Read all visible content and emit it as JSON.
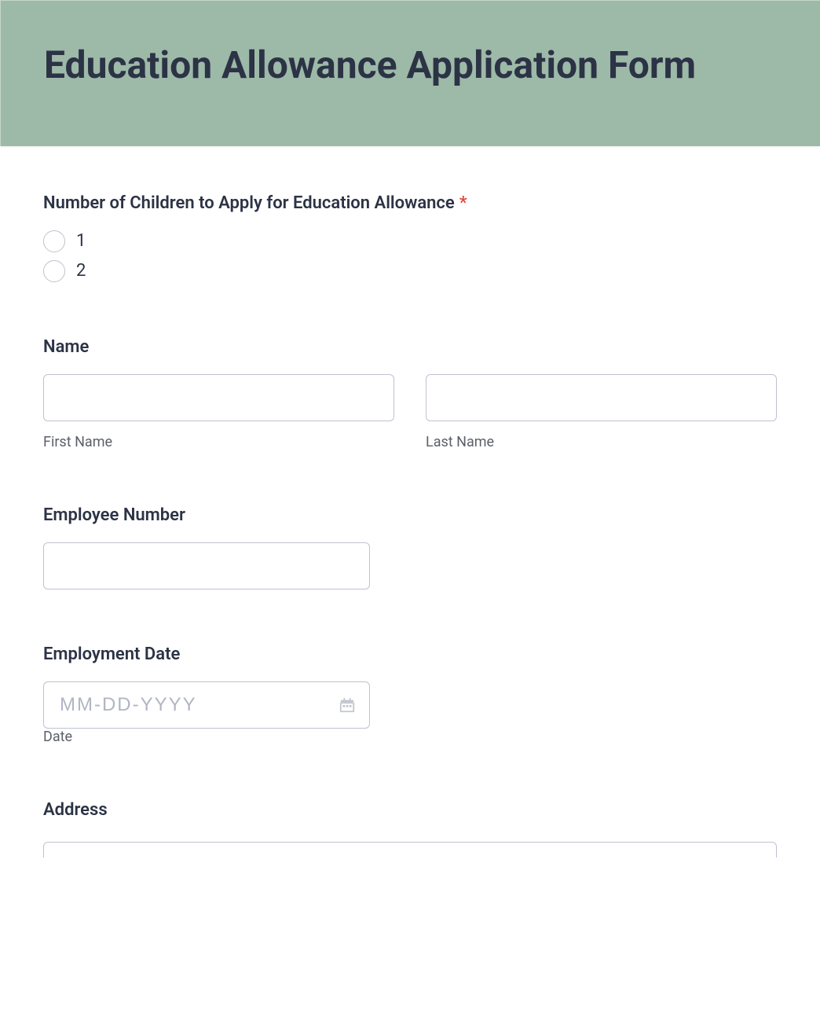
{
  "header": {
    "title": "Education Allowance Application Form"
  },
  "fields": {
    "children": {
      "label": "Number of Children to Apply for Education Allowance",
      "required_marker": "*",
      "options": [
        "1",
        "2"
      ]
    },
    "name": {
      "label": "Name",
      "first_sub": "First Name",
      "last_sub": "Last Name"
    },
    "employee_number": {
      "label": "Employee Number"
    },
    "employment_date": {
      "label": "Employment Date",
      "placeholder": "MM-DD-YYYY",
      "sub": "Date"
    },
    "address": {
      "label": "Address"
    }
  }
}
